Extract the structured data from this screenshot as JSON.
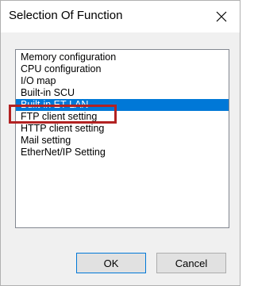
{
  "window": {
    "title": "Selection Of Function"
  },
  "list": {
    "items": [
      "Memory configuration",
      "CPU configuration",
      "I/O map",
      "Built-in SCU",
      "Built-in ET-LAN",
      "FTP client setting",
      "HTTP client setting",
      "Mail setting",
      "EtherNet/IP Setting"
    ],
    "selected_index": 4
  },
  "buttons": {
    "ok_label": "OK",
    "cancel_label": "Cancel"
  },
  "colors": {
    "selection": "#0078d7",
    "highlight_box": "#b22222"
  }
}
